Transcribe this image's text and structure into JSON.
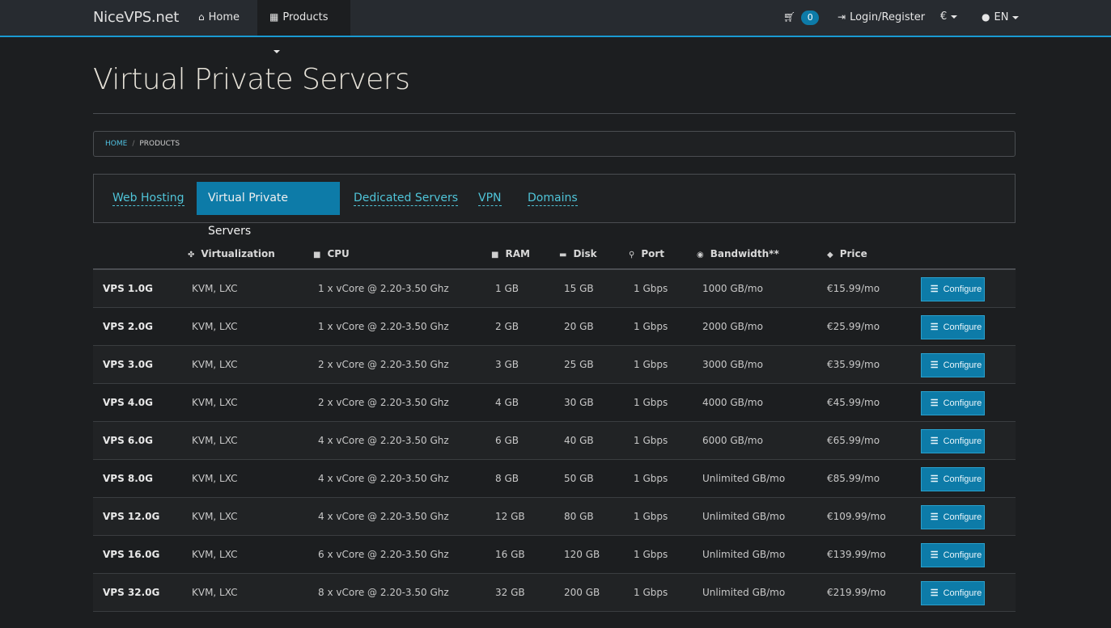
{
  "navbar": {
    "brand": "NiceVPS.net",
    "home_label": "Home",
    "products_label": "Products",
    "cart_count": "0",
    "login_label": "Login/Register",
    "currency_label": "€",
    "language_label": "EN"
  },
  "page": {
    "title": "Virtual Private Servers"
  },
  "breadcrumb": {
    "home": "HOME",
    "separator": "/",
    "current": "PRODUCTS"
  },
  "tabs": [
    {
      "label": "Web Hosting",
      "active": false
    },
    {
      "label": "Virtual Private Servers",
      "active": true
    },
    {
      "label": "Dedicated Servers",
      "active": false
    },
    {
      "label": "VPN",
      "active": false
    },
    {
      "label": "Domains",
      "active": false
    }
  ],
  "table": {
    "headers": {
      "virtualization": "Virtualization",
      "cpu": "CPU",
      "ram": "RAM",
      "disk": "Disk",
      "port": "Port",
      "bandwidth": "Bandwidth**",
      "price": "Price"
    },
    "button_label": "Configure",
    "rows": [
      {
        "name": "VPS 1.0G",
        "virt": "KVM, LXC",
        "cpu": "1 x vCore @ 2.20-3.50 Ghz",
        "ram": "1 GB",
        "disk": "15 GB",
        "port": "1 Gbps",
        "bw": "1000 GB/mo",
        "price": "€15.99/mo"
      },
      {
        "name": "VPS 2.0G",
        "virt": "KVM, LXC",
        "cpu": "1 x vCore @ 2.20-3.50 Ghz",
        "ram": "2 GB",
        "disk": "20 GB",
        "port": "1 Gbps",
        "bw": "2000 GB/mo",
        "price": "€25.99/mo"
      },
      {
        "name": "VPS 3.0G",
        "virt": "KVM, LXC",
        "cpu": "2 x vCore @ 2.20-3.50 Ghz",
        "ram": "3 GB",
        "disk": "25 GB",
        "port": "1 Gbps",
        "bw": "3000 GB/mo",
        "price": "€35.99/mo"
      },
      {
        "name": "VPS 4.0G",
        "virt": "KVM, LXC",
        "cpu": "2 x vCore @ 2.20-3.50 Ghz",
        "ram": "4 GB",
        "disk": "30 GB",
        "port": "1 Gbps",
        "bw": "4000 GB/mo",
        "price": "€45.99/mo"
      },
      {
        "name": "VPS 6.0G",
        "virt": "KVM, LXC",
        "cpu": "4 x vCore @ 2.20-3.50 Ghz",
        "ram": "6 GB",
        "disk": "40 GB",
        "port": "1 Gbps",
        "bw": "6000 GB/mo",
        "price": "€65.99/mo"
      },
      {
        "name": "VPS 8.0G",
        "virt": "KVM, LXC",
        "cpu": "4 x vCore @ 2.20-3.50 Ghz",
        "ram": "8 GB",
        "disk": "50 GB",
        "port": "1 Gbps",
        "bw": "Unlimited GB/mo",
        "price": "€85.99/mo"
      },
      {
        "name": "VPS 12.0G",
        "virt": "KVM, LXC",
        "cpu": "4 x vCore @ 2.20-3.50 Ghz",
        "ram": "12 GB",
        "disk": "80 GB",
        "port": "1 Gbps",
        "bw": "Unlimited GB/mo",
        "price": "€109.99/mo"
      },
      {
        "name": "VPS 16.0G",
        "virt": "KVM, LXC",
        "cpu": "6 x vCore @ 2.20-3.50 Ghz",
        "ram": "16 GB",
        "disk": "120 GB",
        "port": "1 Gbps",
        "bw": "Unlimited GB/mo",
        "price": "€139.99/mo"
      },
      {
        "name": "VPS 32.0G",
        "virt": "KVM, LXC",
        "cpu": "8 x vCore @ 2.20-3.50 Ghz",
        "ram": "32 GB",
        "disk": "200 GB",
        "port": "1 Gbps",
        "bw": "Unlimited GB/mo",
        "price": "€219.99/mo"
      }
    ]
  },
  "colors": {
    "accent": "#1a9ad2",
    "button": "#0d7ba8",
    "link": "#4fc4d8",
    "background": "#1c1e20",
    "navbar": "#272b30"
  }
}
